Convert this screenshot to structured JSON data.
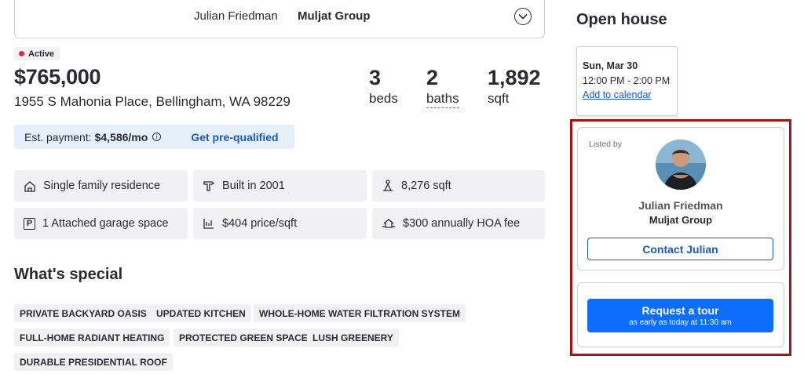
{
  "agent_bar": {
    "name": "Julian Friedman",
    "company": "Muljat Group"
  },
  "status": {
    "label": "Active",
    "color": "#e0274a"
  },
  "listing": {
    "price": "$765,000",
    "address": "1955 S Mahonia Place, Bellingham, WA 98229",
    "beds": {
      "value": "3",
      "label": "beds"
    },
    "baths": {
      "value": "2",
      "label": "baths"
    },
    "sqft": {
      "value": "1,892",
      "label": "sqft"
    }
  },
  "payment": {
    "label": "Est. payment:",
    "amount": "$4,586/mo",
    "info_icon": "i",
    "cta": "Get pre-qualified"
  },
  "facts": [
    {
      "icon": "house-icon",
      "text": "Single family residence"
    },
    {
      "icon": "hammer-icon",
      "text": "Built in 2001"
    },
    {
      "icon": "lot-size-icon",
      "text": "8,276 sqft"
    },
    {
      "icon": "parking-icon",
      "icon_text": "P",
      "text": "1 Attached garage space"
    },
    {
      "icon": "price-per-sqft-icon",
      "text": "$404 price/sqft"
    },
    {
      "icon": "hoa-icon",
      "text": "$300 annually HOA fee"
    }
  ],
  "whats_special": {
    "title": "What's special",
    "tags": [
      "PRIVATE BACKYARD OASIS",
      "UPDATED KITCHEN",
      "WHOLE-HOME WATER FILTRATION SYSTEM",
      "FULL-HOME RADIANT HEATING",
      "PROTECTED GREEN SPACE",
      "LUSH GREENERY",
      "DURABLE PRESIDENTIAL ROOF"
    ]
  },
  "open_house": {
    "title": "Open house",
    "date": "Sun, Mar 30",
    "time": "12:00 PM - 2:00 PM",
    "add_to_calendar": "Add to calendar"
  },
  "listed_by": {
    "label": "Listed by",
    "name": "Julian Friedman",
    "company": "Muljat Group",
    "contact_button": "Contact Julian"
  },
  "tour": {
    "button": "Request a tour",
    "subtext": "as early as today at 11:30 am"
  },
  "colors": {
    "link": "#1a5bb5",
    "primary_button": "#0d6efd",
    "highlight_frame": "#a31414",
    "payment_bg": "#e6f0fa"
  }
}
